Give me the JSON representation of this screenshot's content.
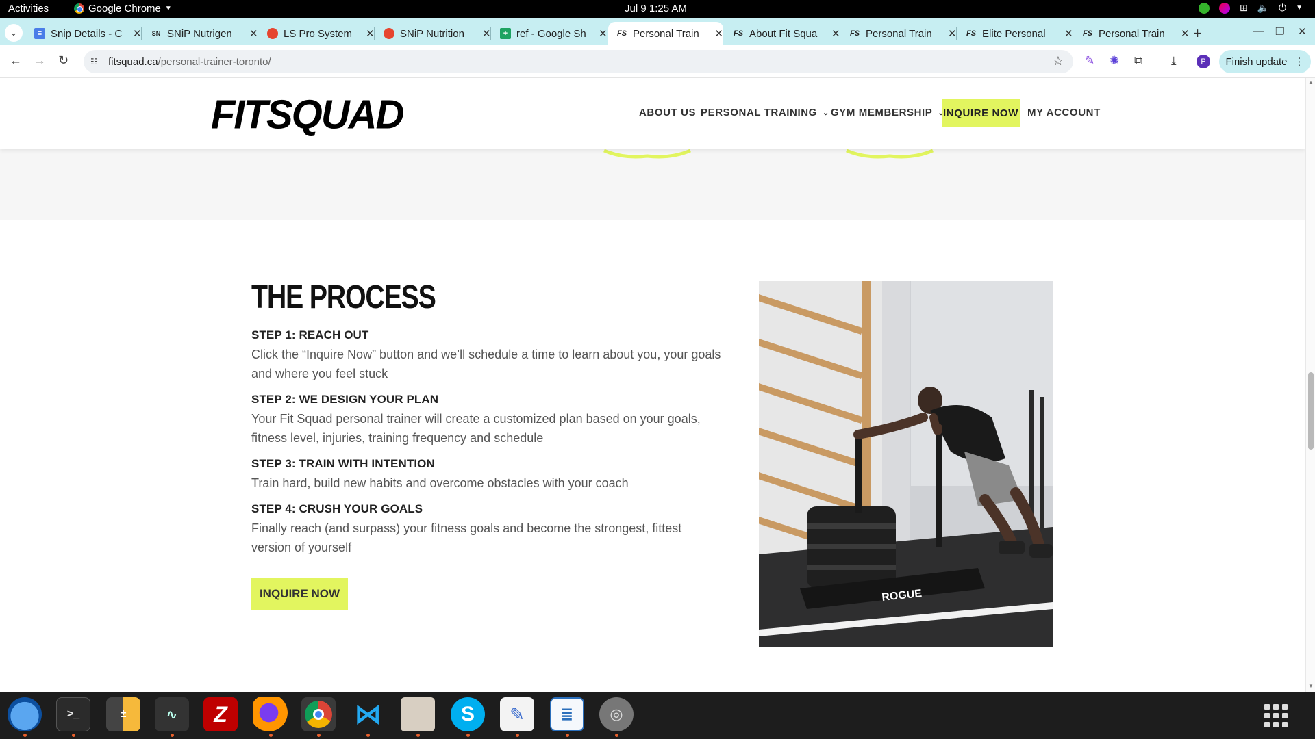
{
  "os_bar": {
    "activities": "Activities",
    "app_name": "Google Chrome",
    "datetime": "Jul 9  1:25 AM"
  },
  "tabs": [
    {
      "label": "Snip Details - C",
      "icon": "doc-icon"
    },
    {
      "label": "SNiP Nutrigen",
      "icon": "snip-icon"
    },
    {
      "label": "LS Pro System",
      "icon": "ls-icon"
    },
    {
      "label": "SNiP Nutrition",
      "icon": "ls-icon"
    },
    {
      "label": "ref - Google Sh",
      "icon": "sheets-icon"
    },
    {
      "label": "Personal Train",
      "icon": "fs-icon",
      "active": true
    },
    {
      "label": "About Fit Squa",
      "icon": "fs-icon"
    },
    {
      "label": "Personal Train",
      "icon": "fs-icon"
    },
    {
      "label": "Elite Personal",
      "icon": "fs-icon"
    },
    {
      "label": "Personal Train",
      "icon": "fs-icon"
    }
  ],
  "address_bar": {
    "domain": "fitsquad.ca",
    "path": "/personal-trainer-toronto/"
  },
  "toolbar": {
    "finish_update": "Finish update",
    "profile_initial": "P"
  },
  "site": {
    "logo": "FITSQUAD",
    "nav": {
      "about": "ABOUT US",
      "personal_training": "PERSONAL TRAINING",
      "gym_membership": "GYM MEMBERSHIP",
      "inquire": "INQUIRE NOW",
      "account": "MY ACCOUNT"
    },
    "accent_color": "#e2f55f"
  },
  "process": {
    "title": "THE PROCESS",
    "steps": [
      {
        "title": "STEP 1: REACH OUT",
        "desc": "Click the “Inquire Now” button and we’ll schedule a time to learn about you, your goals and where you feel stuck"
      },
      {
        "title": "STEP 2: WE DESIGN YOUR PLAN",
        "desc": "Your Fit Squad personal trainer will create a customized plan based on your goals, fitness level, injuries, training frequency and schedule"
      },
      {
        "title": "STEP 3: TRAIN WITH INTENTION",
        "desc": "Train hard, build new habits and overcome obstacles with your coach"
      },
      {
        "title": "STEP 4: CRUSH YOUR GOALS",
        "desc": "Finally reach (and surpass) your fitness goals and become the strongest, fittest version of yourself"
      }
    ],
    "cta": "INQUIRE NOW",
    "photo_text": "ROGUE"
  },
  "dock": {
    "apps": [
      "thunderbird-icon",
      "terminal-icon",
      "calculator-icon",
      "system-monitor-icon",
      "filezilla-icon",
      "firefox-icon",
      "chrome-icon",
      "vscode-icon",
      "files-icon",
      "skype-icon",
      "text-editor-icon",
      "libreoffice-writer-icon",
      "disk-icon"
    ]
  }
}
